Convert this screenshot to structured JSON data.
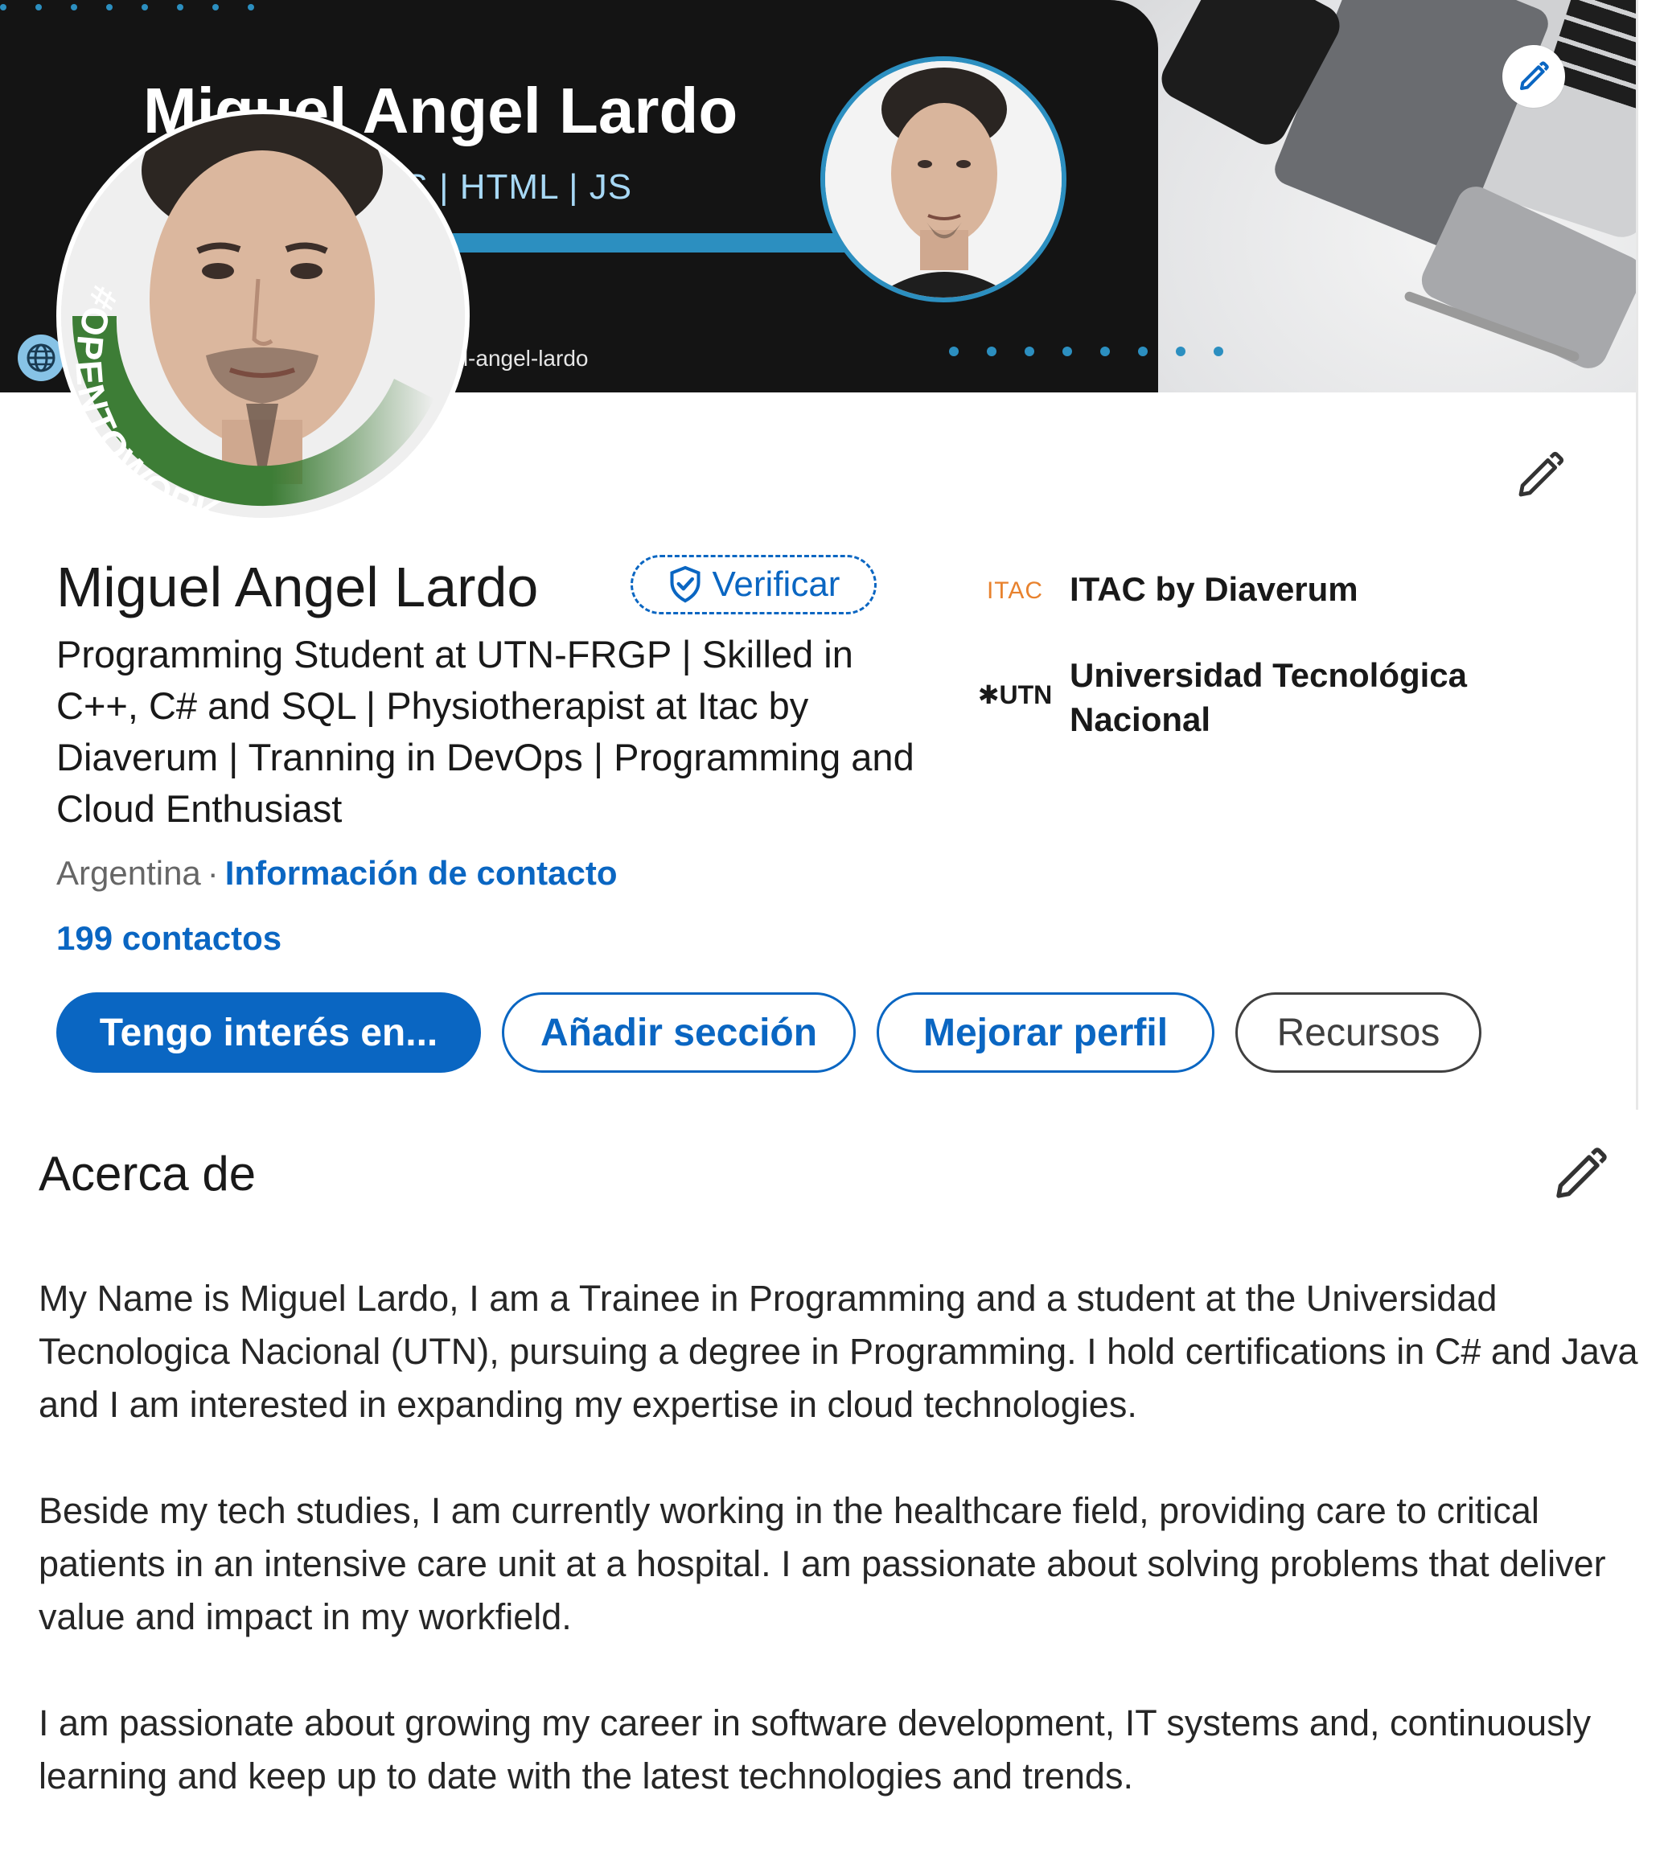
{
  "banner": {
    "name": "Miguel Angel Lardo",
    "skills": "C# | .NET | CSS | HTML | JS",
    "handle": "in/miguel-angel-lardo"
  },
  "avatar": {
    "frame_text": "#OPENTOWORK",
    "frame_color": "#3d7d36"
  },
  "profile": {
    "name": "Miguel Angel Lardo",
    "verify_label": "Verificar",
    "headline": "Programming Student at UTN-FRGP | Skilled in C++, C# and SQL | Physiotherapist at Itac by Diaverum | Tranning in DevOps | Programming and Cloud Enthusiast",
    "location": "Argentina",
    "separator": "·",
    "contact_info_label": "Información de contacto",
    "connections_label": "199 contactos"
  },
  "organizations": [
    {
      "logo_text": "ITAC",
      "name": "ITAC by Diaverum"
    },
    {
      "logo_text": "UTN",
      "name": "Universidad Tecnológica Nacional"
    }
  ],
  "actions": {
    "open_to": "Tengo interés en...",
    "add_section": "Añadir sección",
    "enhance_profile": "Mejorar perfil",
    "resources": "Recursos"
  },
  "about": {
    "title": "Acerca de",
    "paragraphs": [
      "My Name is Miguel Lardo, I am a Trainee in Programming and a student at the Universidad Tecnologica Nacional (UTN), pursuing a degree in Programming. I hold certifications in C# and Java and I am interested in expanding my expertise in cloud technologies.",
      "Beside my tech studies, I am currently working in the healthcare field, providing care to critical patients in an intensive care unit at a hospital. I am passionate about solving problems that deliver value and impact in my workfield.",
      "I am passionate about growing my career in software development, IT systems and, continuously learning and keep up to date with the latest technologies and trends."
    ]
  },
  "colors": {
    "brand": "#0a66c2",
    "banner_dark": "#141414",
    "banner_accent": "#2c8fc0",
    "open_to_work_green": "#3d7d36"
  },
  "icons": {
    "banner_edit": "pencil-icon",
    "intro_edit": "pencil-icon",
    "about_edit": "pencil-icon",
    "verify": "shield-check-icon",
    "globe": "globe-icon"
  }
}
